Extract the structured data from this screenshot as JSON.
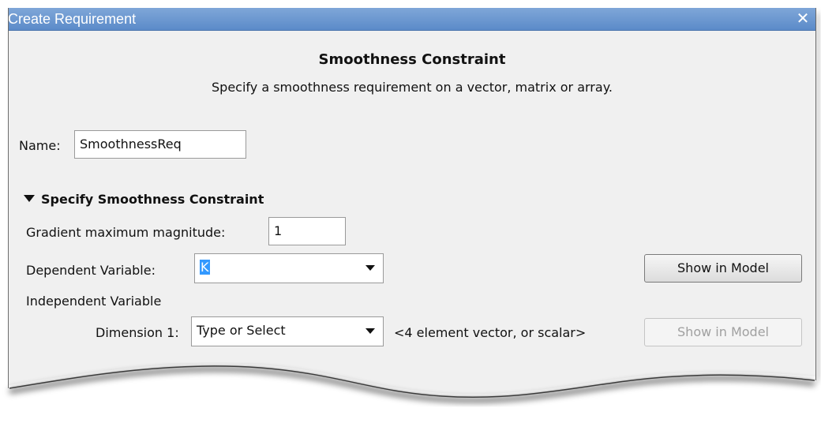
{
  "window": {
    "title": "Create Requirement",
    "close_icon": "close-icon"
  },
  "header": {
    "title": "Smoothness Constraint",
    "description": "Specify a smoothness requirement on a vector, matrix or array."
  },
  "name_field": {
    "label": "Name:",
    "value": "SmoothnessReq"
  },
  "section": {
    "title": "Specify Smoothness Constraint",
    "expanded": true,
    "gradient": {
      "label": "Gradient maximum magnitude:",
      "value": "1"
    },
    "dependent": {
      "label": "Dependent Variable:",
      "value": "K",
      "button": "Show in Model"
    },
    "independent": {
      "label": "Independent Variable",
      "dimension_label": "Dimension 1:",
      "dimension_value": "Type or Select",
      "hint": "<4 element vector, or scalar>",
      "button": "Show in Model",
      "button_enabled": false
    }
  },
  "colors": {
    "titlebar": "#5b8bc9",
    "background": "#f0f0f0",
    "selection": "#3399ff"
  }
}
